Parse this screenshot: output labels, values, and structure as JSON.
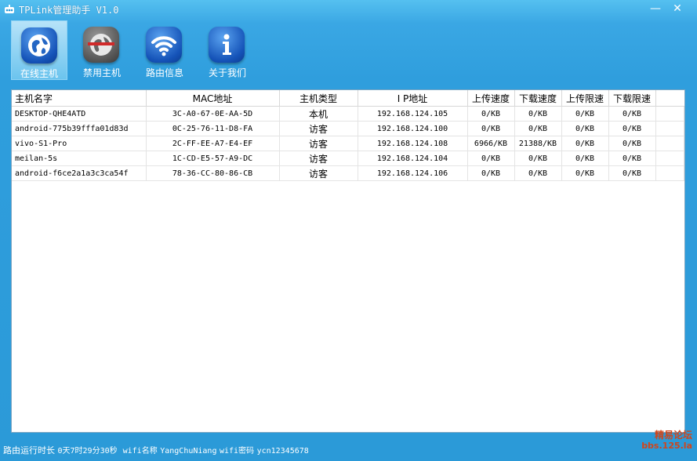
{
  "window": {
    "title": "TPLink管理助手 V1.0",
    "minimize": "—",
    "close": "✕"
  },
  "toolbar": {
    "items": [
      {
        "label": "在线主机",
        "icon": "globe-icon",
        "active": true
      },
      {
        "label": "禁用主机",
        "icon": "globe-banned-icon",
        "active": false
      },
      {
        "label": "路由信息",
        "icon": "wifi-icon",
        "active": false
      },
      {
        "label": "关于我们",
        "icon": "info-icon",
        "active": false
      }
    ]
  },
  "table": {
    "columns": [
      "主机名字",
      "MAC地址",
      "主机类型",
      "I P地址",
      "上传速度",
      "下载速度",
      "上传限速",
      "下载限速"
    ],
    "rows": [
      [
        "DESKTOP-QHE4ATD",
        "3C-A0-67-0E-AA-5D",
        "本机",
        "192.168.124.105",
        "0/KB",
        "0/KB",
        "0/KB",
        "0/KB"
      ],
      [
        "android-775b39fffa01d83d",
        "0C-25-76-11-D8-FA",
        "访客",
        "192.168.124.100",
        "0/KB",
        "0/KB",
        "0/KB",
        "0/KB"
      ],
      [
        "vivo-S1-Pro",
        "2C-FF-EE-A7-E4-EF",
        "访客",
        "192.168.124.108",
        "6966/KB",
        "21388/KB",
        "0/KB",
        "0/KB"
      ],
      [
        "meilan-5s",
        "1C-CD-E5-57-A9-DC",
        "访客",
        "192.168.124.104",
        "0/KB",
        "0/KB",
        "0/KB",
        "0/KB"
      ],
      [
        "android-f6ce2a1a3c3ca54f",
        "78-36-CC-80-86-CB",
        "访客",
        "192.168.124.106",
        "0/KB",
        "0/KB",
        "0/KB",
        "0/KB"
      ]
    ]
  },
  "status": {
    "uptime_label": "路由运行时长",
    "uptime_value": "0天7时29分30秒",
    "wifi_name_label": "wifi名称",
    "wifi_name_value": "YangChuNiang",
    "wifi_pwd_label": "wifi密码",
    "wifi_pwd_value": "ycn12345678"
  },
  "watermark": {
    "line1": "精易论坛",
    "line2": "bbs.125.la"
  }
}
